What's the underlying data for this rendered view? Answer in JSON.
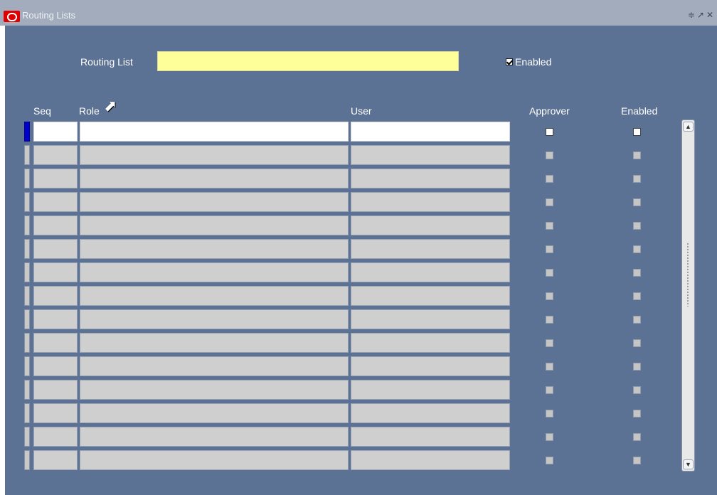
{
  "window": {
    "title": "Routing Lists"
  },
  "form": {
    "routing_list_label": "Routing List",
    "routing_list_value": "",
    "enabled_label": "Enabled",
    "enabled_checked": true
  },
  "columns": {
    "seq": "Seq",
    "role": "Role",
    "user": "User",
    "approver": "Approver",
    "enabled": "Enabled"
  },
  "rows": [
    {
      "seq": "",
      "role": "",
      "user": "",
      "approver": false,
      "enabled": false
    },
    {
      "seq": "",
      "role": "",
      "user": "",
      "approver": false,
      "enabled": false
    },
    {
      "seq": "",
      "role": "",
      "user": "",
      "approver": false,
      "enabled": false
    },
    {
      "seq": "",
      "role": "",
      "user": "",
      "approver": false,
      "enabled": false
    },
    {
      "seq": "",
      "role": "",
      "user": "",
      "approver": false,
      "enabled": false
    },
    {
      "seq": "",
      "role": "",
      "user": "",
      "approver": false,
      "enabled": false
    },
    {
      "seq": "",
      "role": "",
      "user": "",
      "approver": false,
      "enabled": false
    },
    {
      "seq": "",
      "role": "",
      "user": "",
      "approver": false,
      "enabled": false
    },
    {
      "seq": "",
      "role": "",
      "user": "",
      "approver": false,
      "enabled": false
    },
    {
      "seq": "",
      "role": "",
      "user": "",
      "approver": false,
      "enabled": false
    },
    {
      "seq": "",
      "role": "",
      "user": "",
      "approver": false,
      "enabled": false
    },
    {
      "seq": "",
      "role": "",
      "user": "",
      "approver": false,
      "enabled": false
    },
    {
      "seq": "",
      "role": "",
      "user": "",
      "approver": false,
      "enabled": false
    },
    {
      "seq": "",
      "role": "",
      "user": "",
      "approver": false,
      "enabled": false
    },
    {
      "seq": "",
      "role": "",
      "user": "",
      "approver": false,
      "enabled": false
    }
  ],
  "icons": {
    "app": "oracle-logo-icon",
    "minimize": "minimize-icon",
    "maximize": "maximize-icon",
    "close": "close-icon",
    "scroll_up": "scroll-up-icon",
    "scroll_down": "scroll-down-icon"
  },
  "colors": {
    "canvas": "#5c7294",
    "titlebar": "#a2acbd",
    "required_field": "#ffff99",
    "current_row_indicator": "#0000c8"
  }
}
